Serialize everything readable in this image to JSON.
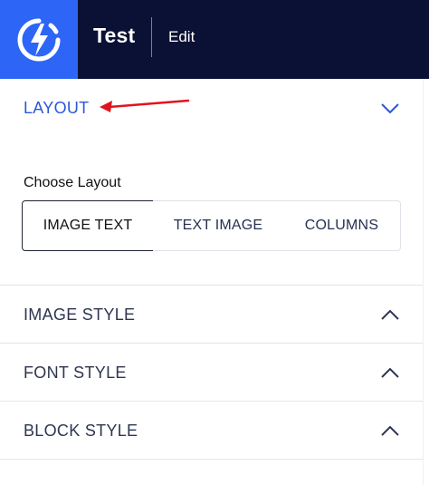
{
  "header": {
    "title": "Test",
    "edit_label": "Edit",
    "brand_color": "#2d66f6",
    "bg_color": "#0b1135"
  },
  "layout_section": {
    "label": "LAYOUT",
    "expanded": true,
    "choose_label": "Choose Layout",
    "options": [
      {
        "label": "IMAGE TEXT",
        "selected": true
      },
      {
        "label": "TEXT IMAGE",
        "selected": false
      },
      {
        "label": "COLUMNS",
        "selected": false
      }
    ]
  },
  "sections": [
    {
      "label": "IMAGE STYLE",
      "expanded": false
    },
    {
      "label": "FONT STYLE",
      "expanded": false
    },
    {
      "label": "BLOCK STYLE",
      "expanded": false
    }
  ],
  "colors": {
    "accent": "#2b57d9",
    "annotation_arrow": "#e0141e"
  }
}
